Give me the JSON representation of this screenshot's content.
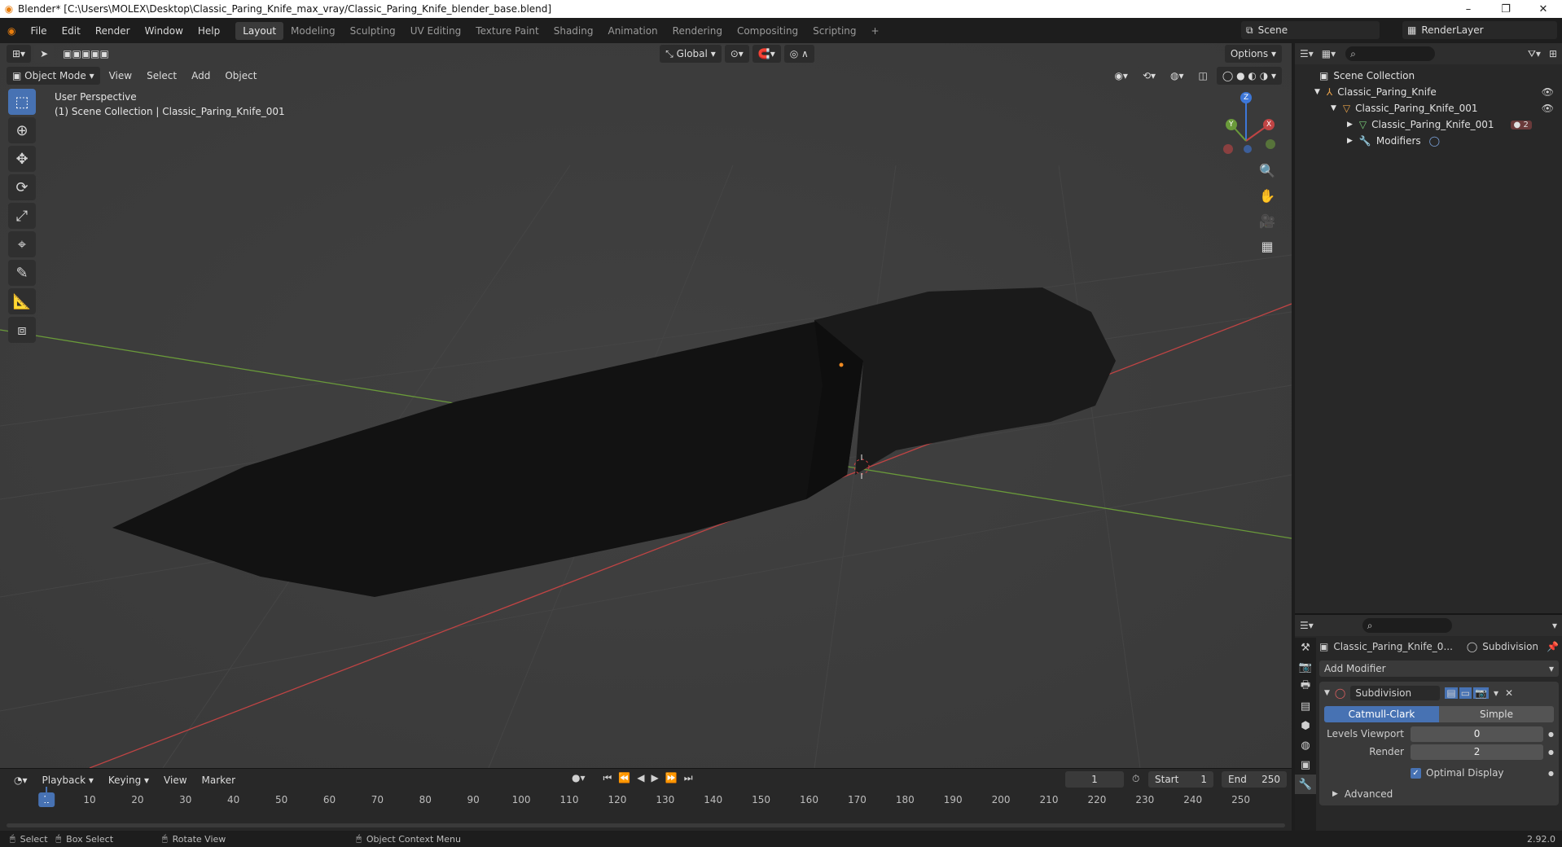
{
  "window": {
    "title": "Blender* [C:\\Users\\MOLEX\\Desktop\\Classic_Paring_Knife_max_vray/Classic_Paring_Knife_blender_base.blend]",
    "minimize": "–",
    "restore": "❐",
    "close": "✕"
  },
  "menu": [
    "File",
    "Edit",
    "Render",
    "Window",
    "Help"
  ],
  "workspaces": [
    "Layout",
    "Modeling",
    "Sculpting",
    "UV Editing",
    "Texture Paint",
    "Shading",
    "Animation",
    "Rendering",
    "Compositing",
    "Scripting"
  ],
  "add_workspace": "+",
  "scene": {
    "name": "Scene",
    "render_layer": "RenderLayer"
  },
  "viewport": {
    "transform_orientation": "Global",
    "options": "Options",
    "mode": "Object Mode",
    "menus": [
      "View",
      "Select",
      "Add",
      "Object"
    ],
    "perspective": "User Perspective",
    "collection_info": "(1) Scene Collection | Classic_Paring_Knife_001",
    "gizmo": {
      "z": "Z",
      "y": "Y",
      "x": "X"
    }
  },
  "outliner": {
    "root": "Scene Collection",
    "items": [
      {
        "label": "Classic_Paring_Knife"
      },
      {
        "label": "Classic_Paring_Knife_001"
      },
      {
        "label": "Classic_Paring_Knife_001"
      },
      {
        "label": "Modifiers"
      }
    ],
    "mesh_badge": "2"
  },
  "properties": {
    "object_name": "Classic_Paring_Knife_0...",
    "modifier_context": "Subdivision",
    "add_modifier": "Add Modifier",
    "modifier": {
      "name": "Subdivision",
      "types": [
        "Catmull-Clark",
        "Simple"
      ],
      "selected_type": "Catmull-Clark",
      "levels_viewport_label": "Levels Viewport",
      "levels_viewport": "0",
      "render_label": "Render",
      "render": "2",
      "optimal_display_label": "Optimal Display",
      "optimal_display": true,
      "advanced_label": "Advanced"
    }
  },
  "timeline": {
    "menus": [
      "Playback",
      "Keying",
      "View",
      "Marker"
    ],
    "current_frame": "1",
    "start_label": "Start",
    "start": "1",
    "end_label": "End",
    "end": "250",
    "ruler_labels": [
      "10",
      "20",
      "30",
      "40",
      "50",
      "60",
      "70",
      "80",
      "90",
      "100",
      "110",
      "120",
      "130",
      "140",
      "150",
      "160",
      "170",
      "180",
      "190",
      "200",
      "210",
      "220",
      "230",
      "240",
      "250"
    ]
  },
  "statusbar": {
    "select": "Select",
    "box_select": "Box Select",
    "rotate_view": "Rotate View",
    "context_menu": "Object Context Menu",
    "version": "2.92.0"
  },
  "colors": {
    "accent": "#4772b3",
    "x_axis": "#c04444",
    "y_axis": "#6a9a3a",
    "z_axis": "#3d77d8",
    "brand": "#e87d0d"
  }
}
